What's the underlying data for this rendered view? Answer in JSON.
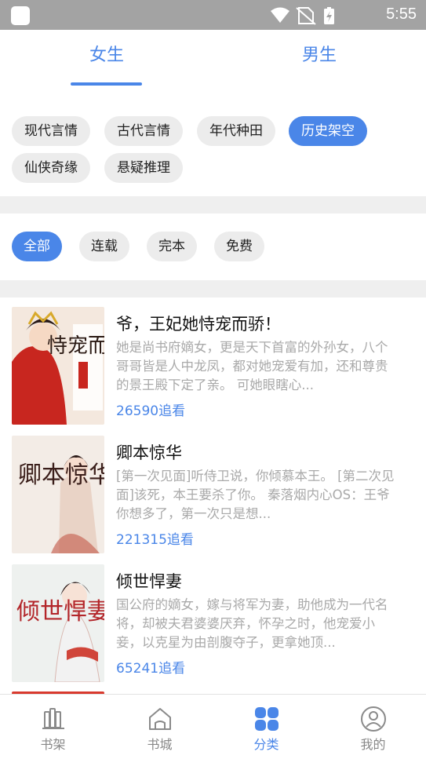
{
  "status_bar": {
    "time": "5:55",
    "icons": [
      "wifi-icon",
      "no-sim-icon",
      "battery-charging-icon"
    ]
  },
  "gender_tabs": [
    {
      "label": "女生",
      "active": true
    },
    {
      "label": "男生",
      "active": false
    }
  ],
  "categories": [
    {
      "label": "现代言情",
      "active": false
    },
    {
      "label": "古代言情",
      "active": false
    },
    {
      "label": "年代种田",
      "active": false
    },
    {
      "label": "历史架空",
      "active": true
    },
    {
      "label": "仙侠奇缘",
      "active": false
    },
    {
      "label": "悬疑推理",
      "active": false
    }
  ],
  "status_filters": [
    {
      "label": "全部",
      "active": true
    },
    {
      "label": "连载",
      "active": false
    },
    {
      "label": "完本",
      "active": false
    },
    {
      "label": "免费",
      "active": false
    }
  ],
  "books": [
    {
      "title": "爷，王妃她恃宠而骄！",
      "description": "她是尚书府嫡女，更是天下首富的外孙女，八个哥哥皆是人中龙凤，都对她宠爱有加，还和尊贵的景王殿下定了亲。 可她眼瞎心...",
      "follow": "26590追看",
      "cover_text": "恃宠而骄"
    },
    {
      "title": "卿本惊华",
      "description": "[第一次见面]听侍卫说，你倾慕本王。 [第二次见面]该死，本王要杀了你。 秦落烟内心OS：王爷你想多了，第一次只是想...",
      "follow": "221315追看",
      "cover_text": "卿本惊华"
    },
    {
      "title": "倾世悍妻",
      "description": "国公府的嫡女，嫁与将军为妻，助他成为一代名将，却被夫君婆婆厌弃，怀孕之时，他宠爱小妾，以克星为由剖腹夺子，更拿她顶...",
      "follow": "65241追看",
      "cover_text": "倾世悍妻"
    }
  ],
  "bottom_nav": [
    {
      "label": "书架",
      "icon": "bookshelf-icon",
      "active": false
    },
    {
      "label": "书城",
      "icon": "home-icon",
      "active": false
    },
    {
      "label": "分类",
      "icon": "category-grid-icon",
      "active": true
    },
    {
      "label": "我的",
      "icon": "profile-icon",
      "active": false
    }
  ],
  "colors": {
    "accent": "#4a86e8",
    "chip_bg": "#ececec",
    "status_bar": "#a3a3a3",
    "muted_text": "#a9a9a9"
  }
}
